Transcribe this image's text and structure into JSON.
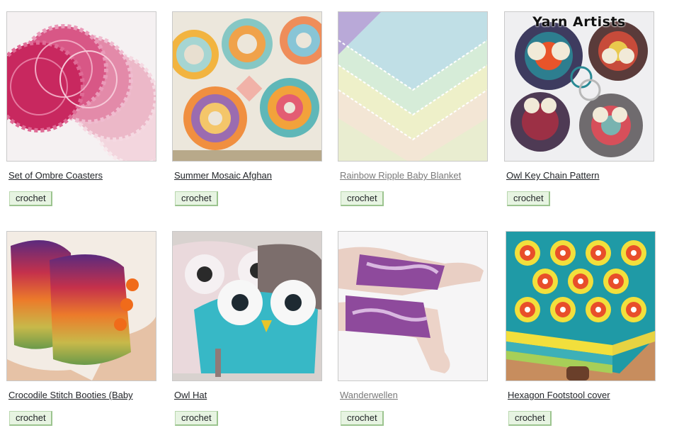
{
  "patterns": [
    {
      "title": "Set of Ombre Coasters",
      "tag": "crochet",
      "image": "pink ombre crochet coasters"
    },
    {
      "title": "Summer Mosaic Afghan",
      "tag": "crochet",
      "image": "mosaic afghan blanket"
    },
    {
      "title": "Rainbow Ripple Baby Blanket",
      "tag": "crochet",
      "image": "pastel ripple blanket"
    },
    {
      "title": "Owl Key Chain Pattern",
      "tag": "crochet",
      "image": "crochet owl key chains",
      "overlay_text": "Yarn Artists"
    },
    {
      "title": "Crocodile Stitch Booties (Baby",
      "tag": "crochet",
      "image": "rainbow crocodile stitch booties"
    },
    {
      "title": "Owl Hat",
      "tag": "crochet",
      "image": "crochet owl hats"
    },
    {
      "title": "Wanderwellen",
      "tag": "crochet",
      "image": "purple cabled wrist warmers"
    },
    {
      "title": "Hexagon Footstool cover",
      "tag": "crochet",
      "image": "hexagon crochet footstool"
    }
  ]
}
